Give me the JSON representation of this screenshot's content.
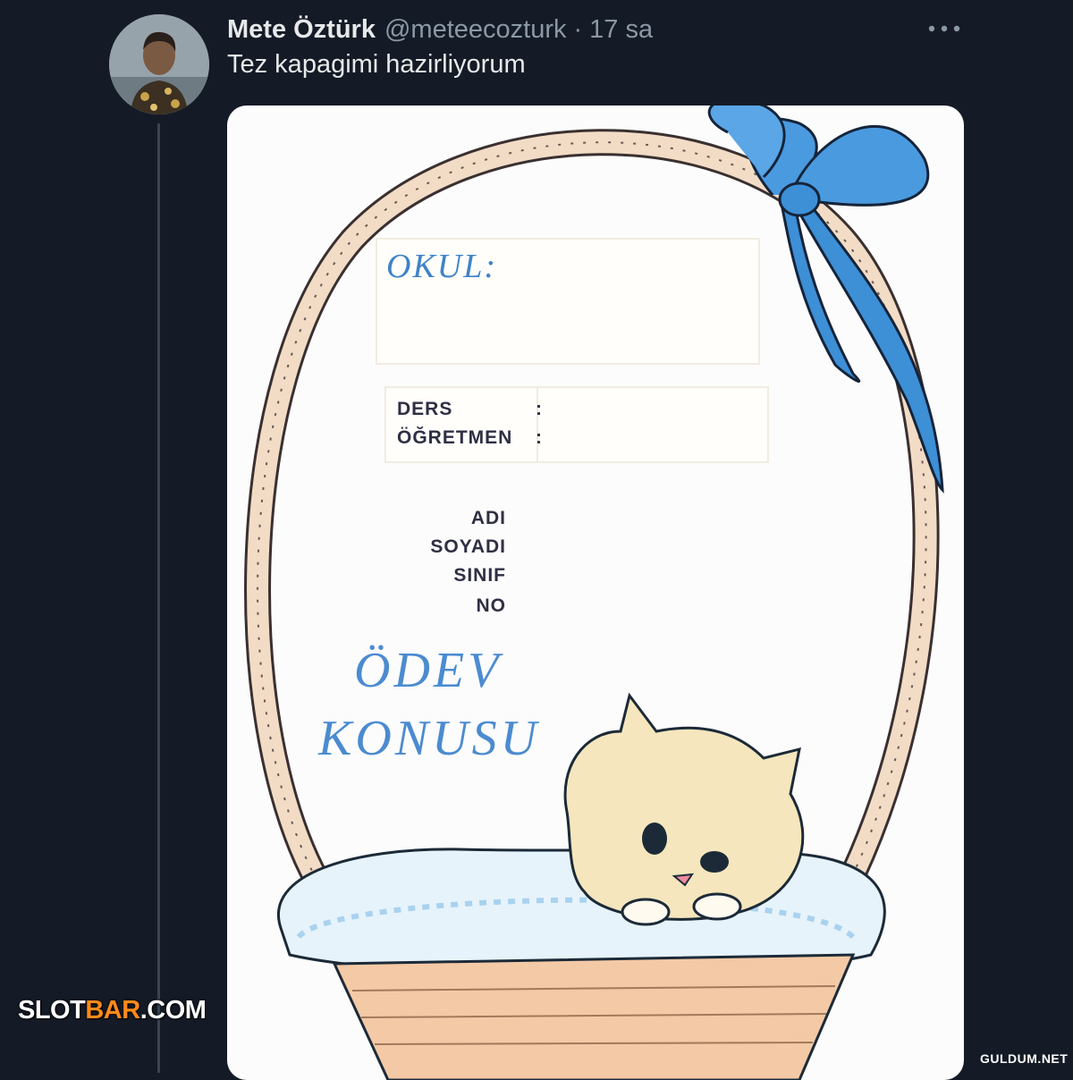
{
  "tweet": {
    "display_name": "Mete Öztürk",
    "handle": "@meteecozturk",
    "separator": "·",
    "time": "17 sa",
    "text": "Tez kapagimi hazirliyorum",
    "more_icon": "more-horizontal-icon"
  },
  "cover": {
    "okul_label": "OKUL:",
    "ders_label": "DERS",
    "ogretmen_label": "ÖĞRETMEN",
    "colon": ":",
    "adi_label": "ADI",
    "soyadi_label": "SOYADI",
    "sinif_label": "SINIF",
    "no_label": "NO",
    "odev_label": "ÖDEV",
    "konusu_label": "KONUSU",
    "colors": {
      "title_blue": "#4b8bd0",
      "ribbon_blue": "#3d8fd6",
      "basket": "#f0d8c0",
      "kitten": "#f5e6bd"
    }
  },
  "watermarks": {
    "left_prefix": "SLOT",
    "left_accent": "BAR",
    "left_suffix": ".COM",
    "right": "GULDUM.NET"
  }
}
